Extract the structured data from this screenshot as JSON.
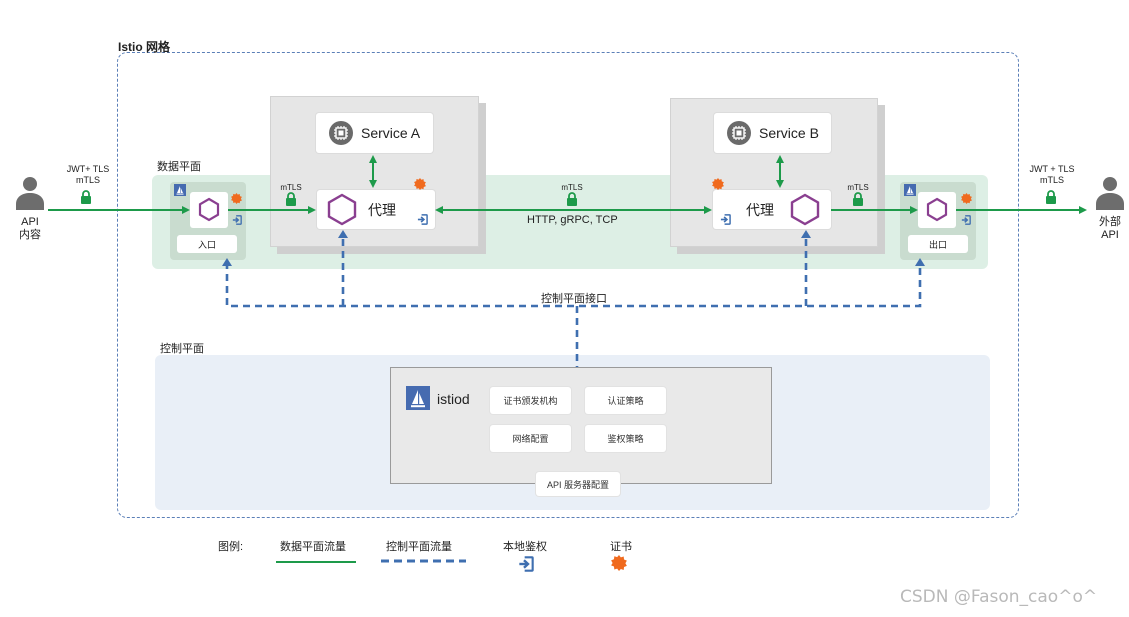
{
  "mesh": {
    "title": "Istio 网格"
  },
  "sections": {
    "data_plane": "数据平面",
    "control_plane": "控制平面"
  },
  "clients": {
    "internal": {
      "line1": "API",
      "line2": "内容",
      "auth_line1": "JWT+ TLS",
      "auth_line2": "mTLS"
    },
    "external": {
      "line1": "外部",
      "line2": "API",
      "auth_line1": "JWT + TLS",
      "auth_line2": "mTLS"
    }
  },
  "gateways": {
    "ingress": "入口",
    "egress": "出口"
  },
  "services": {
    "a": {
      "name": "Service A",
      "proxy": "代理"
    },
    "b": {
      "name": "Service B",
      "proxy": "代理"
    }
  },
  "mtls": {
    "left": "mTLS",
    "center": "mTLS",
    "right": "mTLS"
  },
  "traffic_label": "HTTP, gRPC, TCP",
  "control_plane_api": "控制平面接口",
  "istiod": {
    "name": "istiod",
    "features": [
      "证书颁发机构",
      "认证策略",
      "网络配置",
      "鉴权策略"
    ],
    "api_config": "API 服务器配置"
  },
  "legend": {
    "title": "图例:",
    "data_flow": "数据平面流量",
    "control_flow": "控制平面流量",
    "local_auth": "本地鉴权",
    "certificate": "证书"
  },
  "colors": {
    "data_flow": "#1d9a4a",
    "control_flow": "#3f6fb0",
    "proxy_hex": "#8a3f90",
    "certificate": "#f06a1e",
    "lock": "#1d9a4a"
  },
  "watermark": "CSDN @Fason_cao^o^"
}
